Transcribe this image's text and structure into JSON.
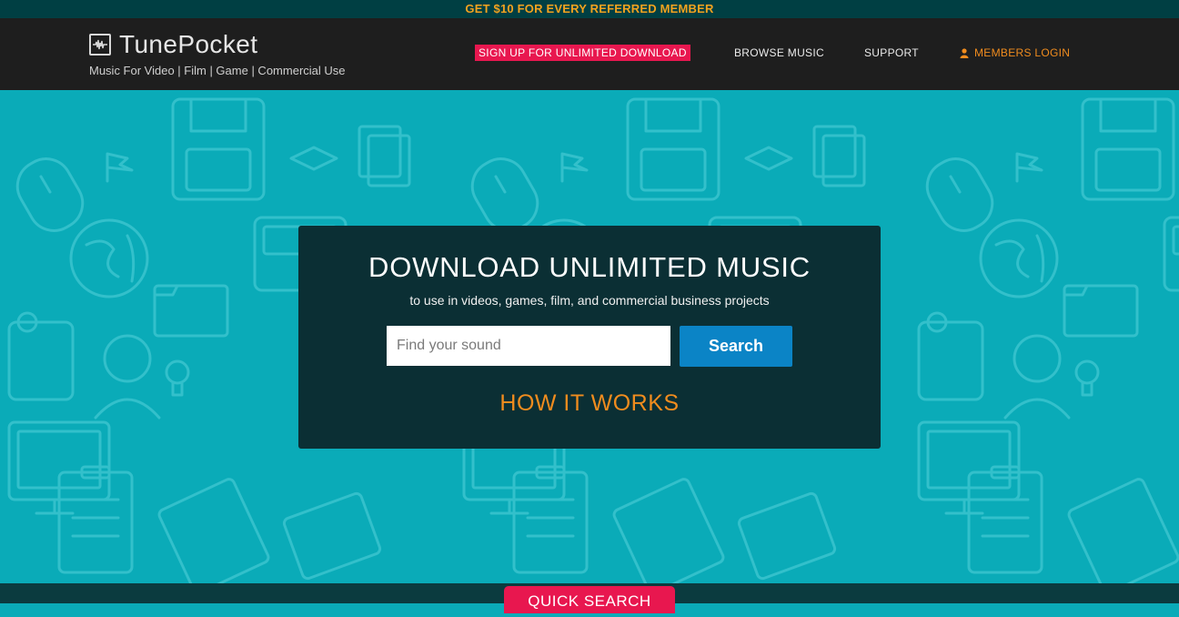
{
  "promo_bar": {
    "text": "GET $10 FOR EVERY REFERRED MEMBER"
  },
  "header": {
    "brand": "TunePocket",
    "tagline": "Music For Video | Film | Game | Commercial Use",
    "logo_icon": "waveform-icon",
    "nav": {
      "signup": "SIGN UP FOR UNLIMITED DOWNLOAD",
      "browse": "BROWSE MUSIC",
      "support": "SUPPORT",
      "login": "MEMBERS LOGIN",
      "login_icon": "user-icon"
    }
  },
  "hero": {
    "title": "DOWNLOAD UNLIMITED MUSIC",
    "subtitle": "to use in videos, games, film, and commercial business projects",
    "search_placeholder": "Find your sound",
    "search_value": "",
    "search_button": "Search",
    "how_it_works": "HOW IT WORKS"
  },
  "footer": {
    "quick_search": "QUICK SEARCH"
  },
  "colors": {
    "promo_bg": "#003f43",
    "promo_text": "#f3a21f",
    "header_bg": "#1e1e1e",
    "hero_bg": "#0aabb8",
    "panel_bg": "#0b2f34",
    "accent_pink": "#e8174f",
    "accent_orange": "#f08c1e",
    "search_blue": "#0b84c6"
  }
}
